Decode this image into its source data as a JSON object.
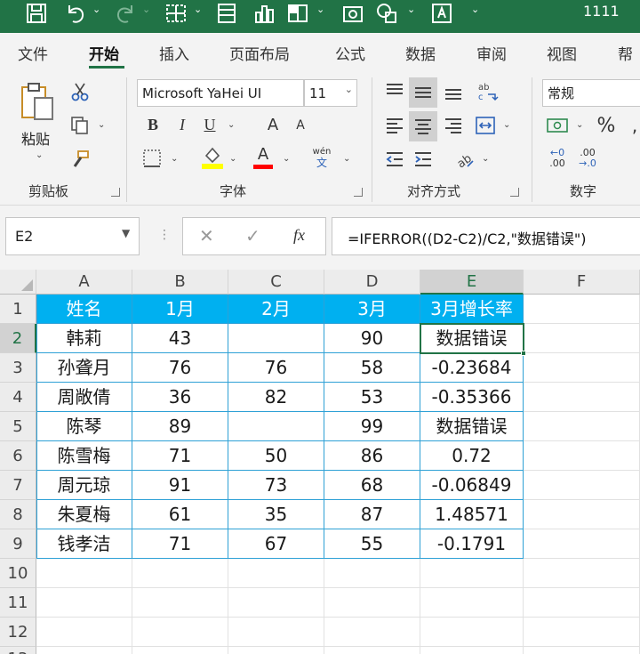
{
  "window": {
    "title": "1111"
  },
  "tabs": [
    {
      "label": "文件",
      "active": false
    },
    {
      "label": "开始",
      "active": true
    },
    {
      "label": "插入",
      "active": false
    },
    {
      "label": "页面布局",
      "active": false
    },
    {
      "label": "公式",
      "active": false
    },
    {
      "label": "数据",
      "active": false
    },
    {
      "label": "审阅",
      "active": false
    },
    {
      "label": "视图",
      "active": false
    },
    {
      "label": "帮",
      "active": false
    }
  ],
  "ribbon": {
    "clipboard": {
      "group_label": "剪贴板",
      "paste_label": "粘贴"
    },
    "font": {
      "group_label": "字体",
      "font_name": "Microsoft YaHei UI",
      "font_size": "11",
      "bold": "B",
      "italic": "I",
      "underline": "U",
      "grow_font": "A",
      "shrink_font": "A",
      "phonetic_top": "wén",
      "phonetic_bottom": "文",
      "highlight_color": "#ffff00",
      "font_color": "#ff0000"
    },
    "alignment": {
      "group_label": "对齐方式"
    },
    "number": {
      "group_label": "数字",
      "format": "常规",
      "percent": "%",
      "inc_decimal_top": "←0",
      "inc_decimal_bottom": ".00",
      "dec_decimal_top": ".00",
      "dec_decimal_bottom": "→.0"
    }
  },
  "formula_bar": {
    "name_box": "E2",
    "fx": "fx",
    "formula": "=IFERROR((D2-C2)/C2,\"数据错误\")"
  },
  "sheet": {
    "columns": [
      "A",
      "B",
      "C",
      "D",
      "E",
      "F"
    ],
    "rows": [
      "1",
      "2",
      "3",
      "4",
      "5",
      "6",
      "7",
      "8",
      "9",
      "10",
      "11",
      "12",
      "13"
    ],
    "selected_cell": "E2",
    "header_fill": "#00b0f0",
    "table_border": "#2ea1d6",
    "cells": [
      [
        "姓名",
        "1月",
        "2月",
        "3月",
        "3月增长率"
      ],
      [
        "韩莉",
        "43",
        "",
        "90",
        "数据错误"
      ],
      [
        "孙聋月",
        "76",
        "76",
        "58",
        "-0.23684"
      ],
      [
        "周敞倩",
        "36",
        "82",
        "53",
        "-0.35366"
      ],
      [
        "陈琴",
        "89",
        "",
        "99",
        "数据错误"
      ],
      [
        "陈雪梅",
        "71",
        "50",
        "86",
        "0.72"
      ],
      [
        "周元琼",
        "91",
        "73",
        "68",
        "-0.06849"
      ],
      [
        "朱夏梅",
        "61",
        "35",
        "87",
        "1.48571"
      ],
      [
        "钱孝洁",
        "71",
        "67",
        "55",
        "-0.1791"
      ]
    ]
  }
}
